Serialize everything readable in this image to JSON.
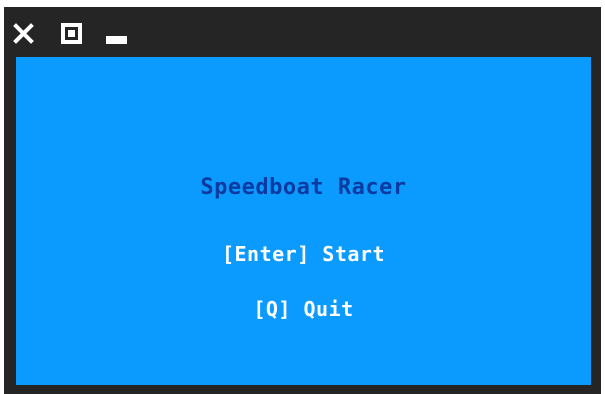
{
  "window": {
    "controls": [
      {
        "name": "close",
        "icon": "close-icon"
      },
      {
        "name": "maximize",
        "icon": "maximize-icon"
      },
      {
        "name": "minimize",
        "icon": "minimize-icon"
      }
    ]
  },
  "game": {
    "title": "Speedboat Racer",
    "menu": {
      "start_label": "[Enter] Start",
      "quit_label": "[Q] Quit"
    }
  },
  "colors": {
    "frame": "#252525",
    "background": "#0b9bff",
    "title": "#0b3aa0",
    "menu_text": "#ffffff"
  }
}
